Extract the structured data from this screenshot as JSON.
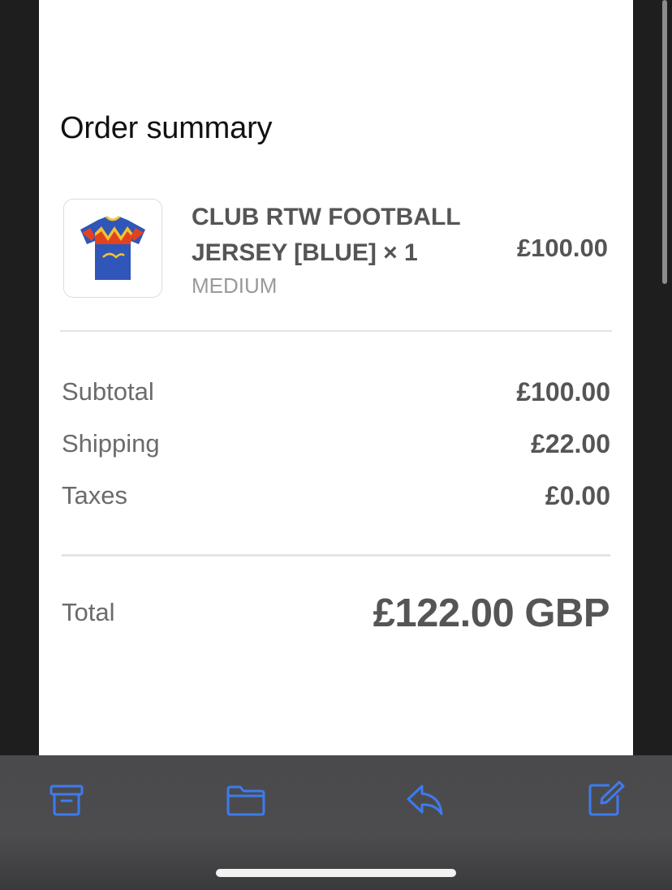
{
  "order": {
    "title": "Order summary",
    "item": {
      "name": "CLUB RTW FOOTBALL JERSEY [BLUE] × 1",
      "variant": "MEDIUM",
      "price": "£100.00",
      "image_icon": "blue-football-jersey-image"
    },
    "subtotal": {
      "label": "Subtotal",
      "value": "£100.00"
    },
    "shipping": {
      "label": "Shipping",
      "value": "£22.00"
    },
    "taxes": {
      "label": "Taxes",
      "value": "£0.00"
    },
    "total": {
      "label": "Total",
      "value": "£122.00 GBP"
    }
  },
  "toolbar": {
    "accent_color": "#3d7bf0",
    "icons": [
      "archive-icon",
      "folder-icon",
      "reply-icon",
      "compose-icon"
    ]
  }
}
